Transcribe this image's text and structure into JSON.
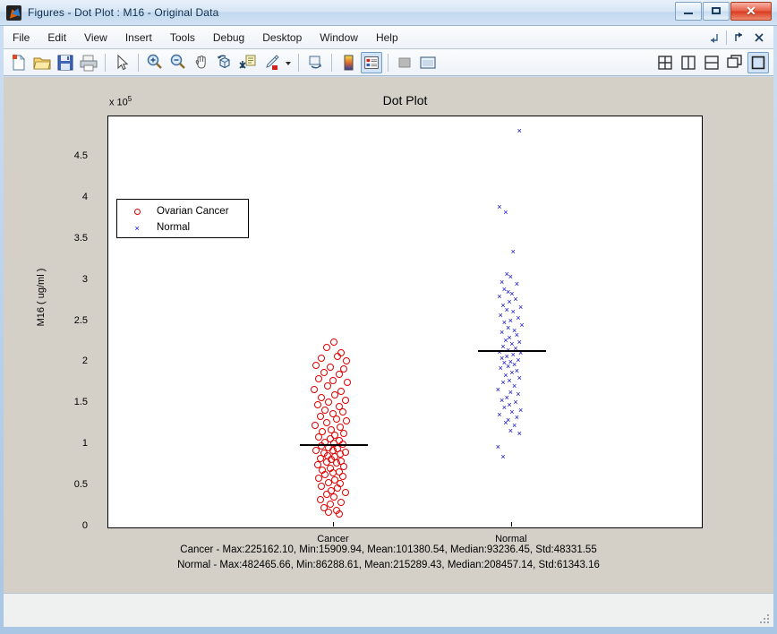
{
  "window": {
    "title": "Figures - Dot Plot : M16 - Original Data",
    "app_icon": "matlab-icon",
    "minimize_label": "–",
    "maximize_label": "□",
    "close_label": "✕"
  },
  "menubar": {
    "items": [
      {
        "label": "File"
      },
      {
        "label": "Edit"
      },
      {
        "label": "View"
      },
      {
        "label": "Insert"
      },
      {
        "label": "Tools"
      },
      {
        "label": "Debug"
      },
      {
        "label": "Desktop"
      },
      {
        "label": "Window"
      },
      {
        "label": "Help"
      }
    ],
    "right_controls": [
      {
        "name": "dock-arrow-icon"
      },
      {
        "name": "undock-arrow-icon"
      },
      {
        "name": "close-icon",
        "label": "✕"
      }
    ]
  },
  "toolbar": {
    "buttons": [
      {
        "name": "new-figure-icon",
        "tooltip": "New Figure"
      },
      {
        "name": "open-file-icon",
        "tooltip": "Open File"
      },
      {
        "name": "save-figure-icon",
        "tooltip": "Save Figure"
      },
      {
        "name": "print-figure-icon",
        "tooltip": "Print Figure"
      },
      {
        "name": "pointer-icon",
        "tooltip": "Edit Plot"
      },
      {
        "name": "zoom-in-icon",
        "tooltip": "Zoom In"
      },
      {
        "name": "zoom-out-icon",
        "tooltip": "Zoom Out"
      },
      {
        "name": "pan-hand-icon",
        "tooltip": "Pan"
      },
      {
        "name": "rotate-3d-icon",
        "tooltip": "Rotate 3D"
      },
      {
        "name": "data-cursor-icon",
        "tooltip": "Data Cursor"
      },
      {
        "name": "brush-icon",
        "tooltip": "Brush/Select Data"
      },
      {
        "name": "link-plot-icon",
        "tooltip": "Link Plot"
      },
      {
        "name": "colorbar-icon",
        "tooltip": "Insert Colorbar"
      },
      {
        "name": "legend-icon",
        "tooltip": "Insert Legend"
      },
      {
        "name": "hide-plot-tools-icon",
        "tooltip": "Hide Plot Tools"
      },
      {
        "name": "show-plot-tools-icon",
        "tooltip": "Show Plot Tools and Dock Figure"
      }
    ],
    "layout_buttons": [
      {
        "name": "tile-four-icon"
      },
      {
        "name": "tile-vertical-icon"
      },
      {
        "name": "tile-horizontal-icon"
      },
      {
        "name": "float-window-icon"
      },
      {
        "name": "maximize-document-icon"
      }
    ]
  },
  "chart_data": {
    "type": "scatter",
    "title": "Dot Plot",
    "xlabel": "",
    "ylabel": "M16 ( ug/ml )",
    "exponent_label": "x 10",
    "exponent_power": "5",
    "ylim": [
      0,
      482465.66
    ],
    "yticks": [
      0,
      50000,
      100000,
      150000,
      200000,
      250000,
      300000,
      350000,
      400000,
      450000
    ],
    "ytick_labels": [
      "0",
      "0.5",
      "1",
      "1.5",
      "2",
      "2.5",
      "3",
      "3.5",
      "4",
      "4.5"
    ],
    "y_axis_scale_factor": 100000,
    "categories": [
      "Cancer",
      "Normal"
    ],
    "grid": false,
    "legend_position": "top-left",
    "series": [
      {
        "name": "Ovarian Cancer",
        "marker": "circle",
        "color": "#e00000",
        "category": "Cancer",
        "median_line": 101380.54,
        "jitter_points": [
          [
            0.5,
            225162
          ],
          [
            0.38,
            219000
          ],
          [
            0.62,
            212000
          ],
          [
            0.3,
            206000
          ],
          [
            0.56,
            208000
          ],
          [
            0.7,
            203000
          ],
          [
            0.22,
            197000
          ],
          [
            0.44,
            195000
          ],
          [
            0.66,
            193000
          ],
          [
            0.34,
            188000
          ],
          [
            0.58,
            186000
          ],
          [
            0.26,
            181000
          ],
          [
            0.48,
            179000
          ],
          [
            0.72,
            176000
          ],
          [
            0.4,
            172000
          ],
          [
            0.18,
            168000
          ],
          [
            0.62,
            166000
          ],
          [
            0.52,
            161000
          ],
          [
            0.3,
            158000
          ],
          [
            0.68,
            155000
          ],
          [
            0.42,
            152000
          ],
          [
            0.24,
            149000
          ],
          [
            0.58,
            147000
          ],
          [
            0.36,
            143000
          ],
          [
            0.64,
            141000
          ],
          [
            0.48,
            138000
          ],
          [
            0.28,
            135000
          ],
          [
            0.54,
            132000
          ],
          [
            0.7,
            130000
          ],
          [
            0.38,
            127000
          ],
          [
            0.2,
            124000
          ],
          [
            0.6,
            122000
          ],
          [
            0.46,
            119000
          ],
          [
            0.32,
            117000
          ],
          [
            0.66,
            114000
          ],
          [
            0.52,
            112000
          ],
          [
            0.26,
            110000
          ],
          [
            0.44,
            108000
          ],
          [
            0.58,
            106000
          ],
          [
            0.36,
            104000
          ],
          [
            0.5,
            102000
          ],
          [
            0.64,
            101000
          ],
          [
            0.3,
            99000
          ],
          [
            0.42,
            97000
          ],
          [
            0.56,
            96000
          ],
          [
            0.22,
            94000
          ],
          [
            0.48,
            93236
          ],
          [
            0.68,
            92000
          ],
          [
            0.34,
            90000
          ],
          [
            0.6,
            89000
          ],
          [
            0.4,
            87000
          ],
          [
            0.52,
            86000
          ],
          [
            0.28,
            84000
          ],
          [
            0.46,
            83000
          ],
          [
            0.62,
            81000
          ],
          [
            0.38,
            79000
          ],
          [
            0.54,
            78000
          ],
          [
            0.24,
            76000
          ],
          [
            0.66,
            74000
          ],
          [
            0.44,
            72000
          ],
          [
            0.32,
            70000
          ],
          [
            0.58,
            68000
          ],
          [
            0.48,
            66000
          ],
          [
            0.36,
            64000
          ],
          [
            0.64,
            62000
          ],
          [
            0.26,
            60000
          ],
          [
            0.52,
            58000
          ],
          [
            0.42,
            55000
          ],
          [
            0.6,
            53000
          ],
          [
            0.3,
            50000
          ],
          [
            0.56,
            48000
          ],
          [
            0.46,
            45000
          ],
          [
            0.68,
            43000
          ],
          [
            0.38,
            40000
          ],
          [
            0.5,
            37000
          ],
          [
            0.28,
            34000
          ],
          [
            0.62,
            31000
          ],
          [
            0.44,
            28000
          ],
          [
            0.34,
            24000
          ],
          [
            0.54,
            21000
          ],
          [
            0.42,
            18000
          ],
          [
            0.58,
            15909
          ]
        ],
        "stats": {
          "max": "225162.10",
          "min": "15909.94",
          "mean": "101380.54",
          "median": "93236.45",
          "std": "48331.55"
        }
      },
      {
        "name": "Normal",
        "marker": "x",
        "color": "#0000cc",
        "category": "Normal",
        "median_line": 215289.43,
        "jitter_points": [
          [
            0.62,
            482465
          ],
          [
            0.3,
            390000
          ],
          [
            0.4,
            383000
          ],
          [
            0.52,
            335000
          ],
          [
            0.42,
            308000
          ],
          [
            0.48,
            305000
          ],
          [
            0.34,
            298000
          ],
          [
            0.58,
            296000
          ],
          [
            0.38,
            290000
          ],
          [
            0.44,
            287000
          ],
          [
            0.5,
            284000
          ],
          [
            0.3,
            281000
          ],
          [
            0.56,
            278000
          ],
          [
            0.46,
            274000
          ],
          [
            0.36,
            270000
          ],
          [
            0.64,
            268000
          ],
          [
            0.42,
            265000
          ],
          [
            0.52,
            262000
          ],
          [
            0.32,
            258000
          ],
          [
            0.6,
            255000
          ],
          [
            0.48,
            252000
          ],
          [
            0.38,
            249000
          ],
          [
            0.66,
            246000
          ],
          [
            0.44,
            243000
          ],
          [
            0.54,
            240000
          ],
          [
            0.34,
            237000
          ],
          [
            0.58,
            234000
          ],
          [
            0.46,
            231000
          ],
          [
            0.4,
            228000
          ],
          [
            0.62,
            226000
          ],
          [
            0.5,
            223000
          ],
          [
            0.36,
            220000
          ],
          [
            0.56,
            218000
          ],
          [
            0.44,
            216000
          ],
          [
            0.3,
            214000
          ],
          [
            0.64,
            212000
          ],
          [
            0.52,
            210000
          ],
          [
            0.42,
            208457
          ],
          [
            0.34,
            206000
          ],
          [
            0.6,
            204000
          ],
          [
            0.48,
            202000
          ],
          [
            0.38,
            200000
          ],
          [
            0.54,
            198000
          ],
          [
            0.44,
            196000
          ],
          [
            0.32,
            194000
          ],
          [
            0.58,
            191000
          ],
          [
            0.5,
            188000
          ],
          [
            0.4,
            185000
          ],
          [
            0.62,
            182000
          ],
          [
            0.46,
            179000
          ],
          [
            0.36,
            176000
          ],
          [
            0.54,
            172000
          ],
          [
            0.28,
            168000
          ],
          [
            0.48,
            165000
          ],
          [
            0.6,
            162000
          ],
          [
            0.42,
            158000
          ],
          [
            0.34,
            155000
          ],
          [
            0.56,
            152000
          ],
          [
            0.46,
            149000
          ],
          [
            0.38,
            146000
          ],
          [
            0.64,
            143000
          ],
          [
            0.5,
            140000
          ],
          [
            0.3,
            137000
          ],
          [
            0.58,
            134000
          ],
          [
            0.44,
            131000
          ],
          [
            0.4,
            127000
          ],
          [
            0.54,
            124000
          ],
          [
            0.48,
            118000
          ],
          [
            0.62,
            114000
          ],
          [
            0.28,
            98000
          ],
          [
            0.36,
            86288
          ]
        ],
        "stats": {
          "max": "482465.66",
          "min": "86288.61",
          "mean": "215289.43",
          "median": "208457.14",
          "std": "61343.16"
        }
      }
    ],
    "legend_entries": [
      {
        "label": "Ovarian Cancer",
        "marker": "circle",
        "color": "#e00000"
      },
      {
        "label": "Normal",
        "marker": "x",
        "color": "#0000cc"
      }
    ],
    "annotations": [
      "Cancer - Max:225162.10, Min:15909.94, Mean:101380.54, Median:93236.45, Std:48331.55",
      "Normal - Max:482465.66, Min:86288.61, Mean:215289.43, Median:208457.14, Std:61343.16"
    ]
  },
  "statusbar": {
    "text": ""
  }
}
